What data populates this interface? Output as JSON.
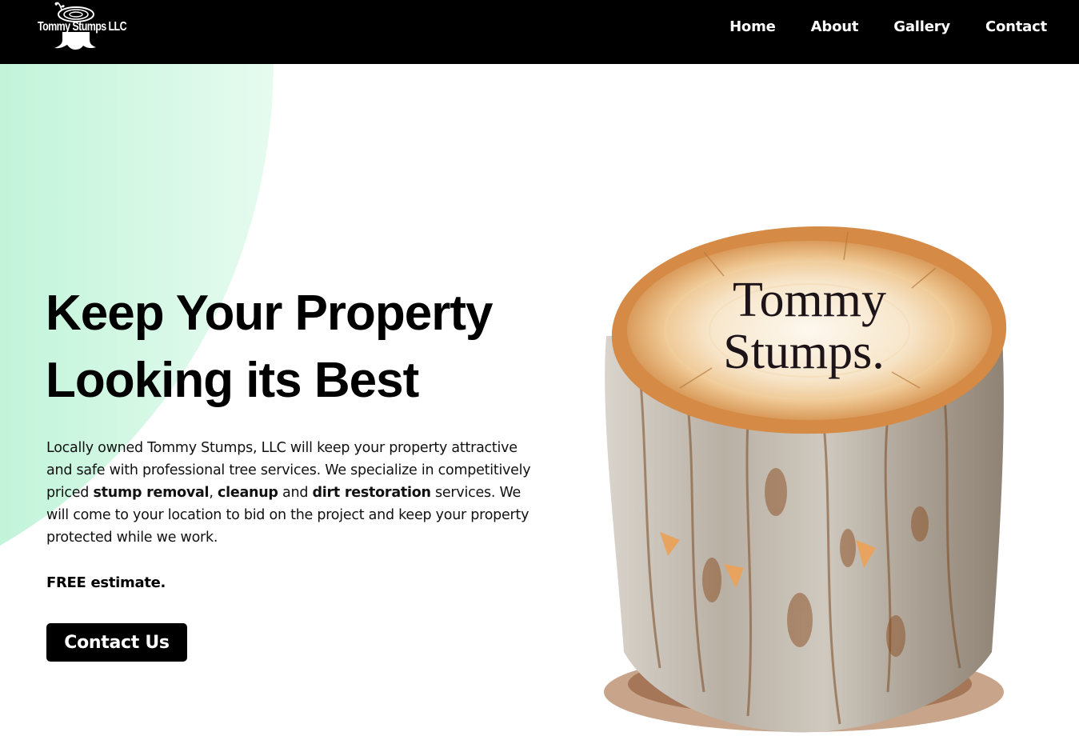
{
  "nav": {
    "logo_text": "Tommy Stumps LLC",
    "links": [
      "Home",
      "About",
      "Gallery",
      "Contact"
    ]
  },
  "hero": {
    "headline_line1": "Keep Your Property",
    "headline_line2": "Looking its Best",
    "desc": {
      "part1": "Locally owned Tommy Stumps, LLC will keep your property attractive and safe with professional tree services. We specialize in competitively priced ",
      "bold1": "stump removal",
      "sep1": ", ",
      "bold2": "cleanup",
      "sep2": " and ",
      "bold3": "dirt restoration",
      "part2": " services. We will come to your location to bid on the project and keep your property protected while we work."
    },
    "estimate": "FREE estimate.",
    "cta_label": "Contact Us"
  },
  "image": {
    "stump_line1": "Tommy",
    "stump_line2": "Stumps."
  },
  "colors": {
    "nav_bg": "#000000",
    "accent_mint": "#c4f5dc",
    "button_bg": "#000000"
  }
}
